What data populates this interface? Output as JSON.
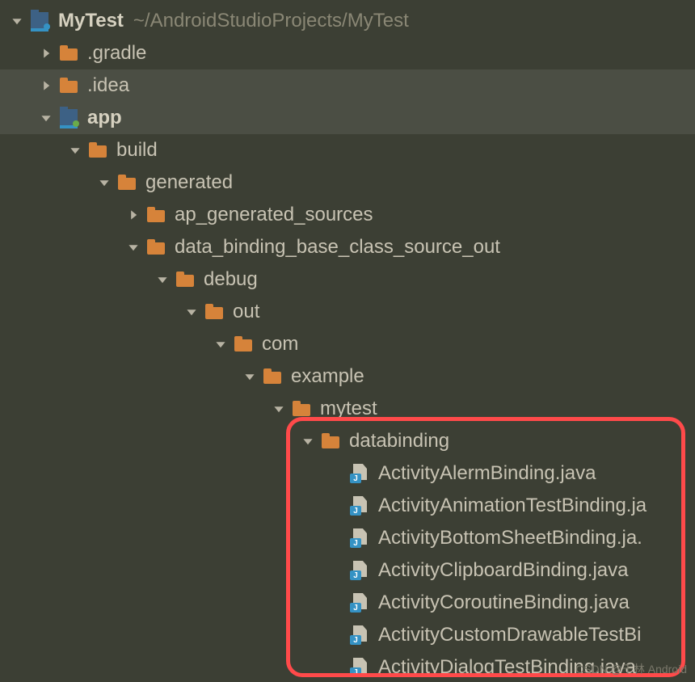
{
  "root": {
    "name": "MyTest",
    "path": "~/AndroidStudioProjects/MyTest"
  },
  "nodes": {
    "gradle": ".gradle",
    "idea": ".idea",
    "app": "app",
    "build": "build",
    "generated": "generated",
    "ap": "ap_generated_sources",
    "dbout": "data_binding_base_class_source_out",
    "debug": "debug",
    "out": "out",
    "com": "com",
    "example": "example",
    "mytest": "mytest",
    "databinding": "databinding"
  },
  "files": [
    "ActivityAlermBinding.java",
    "ActivityAnimationTestBinding.ja",
    "ActivityBottomSheetBinding.ja.",
    "ActivityClipboardBinding.java",
    "ActivityCoroutineBinding.java",
    "ActivityCustomDrawableTestBi",
    "ActivityDialogTestBinding.java"
  ],
  "watermark": "CSDN @千林 Android"
}
